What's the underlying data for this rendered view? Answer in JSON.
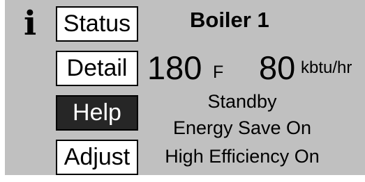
{
  "info_icon": {
    "glyph": "i",
    "icon": "info-icon"
  },
  "nav": {
    "status_label": "Status",
    "detail_label": "Detail",
    "help_label": "Help",
    "adjust_label": "Adjust",
    "active": "Help"
  },
  "boiler": {
    "title": "Boiler 1",
    "temperature_value": "180",
    "temperature_unit": "F",
    "load_value": "80",
    "load_unit": "kbtu/hr"
  },
  "status_lines": {
    "line1": "Standby",
    "line2": "Energy Save On",
    "line3": "High Efficiency On"
  },
  "colors": {
    "panel_bg": "#c0c0c0",
    "active_button_bg": "#262626",
    "button_bg": "#ffffff"
  }
}
